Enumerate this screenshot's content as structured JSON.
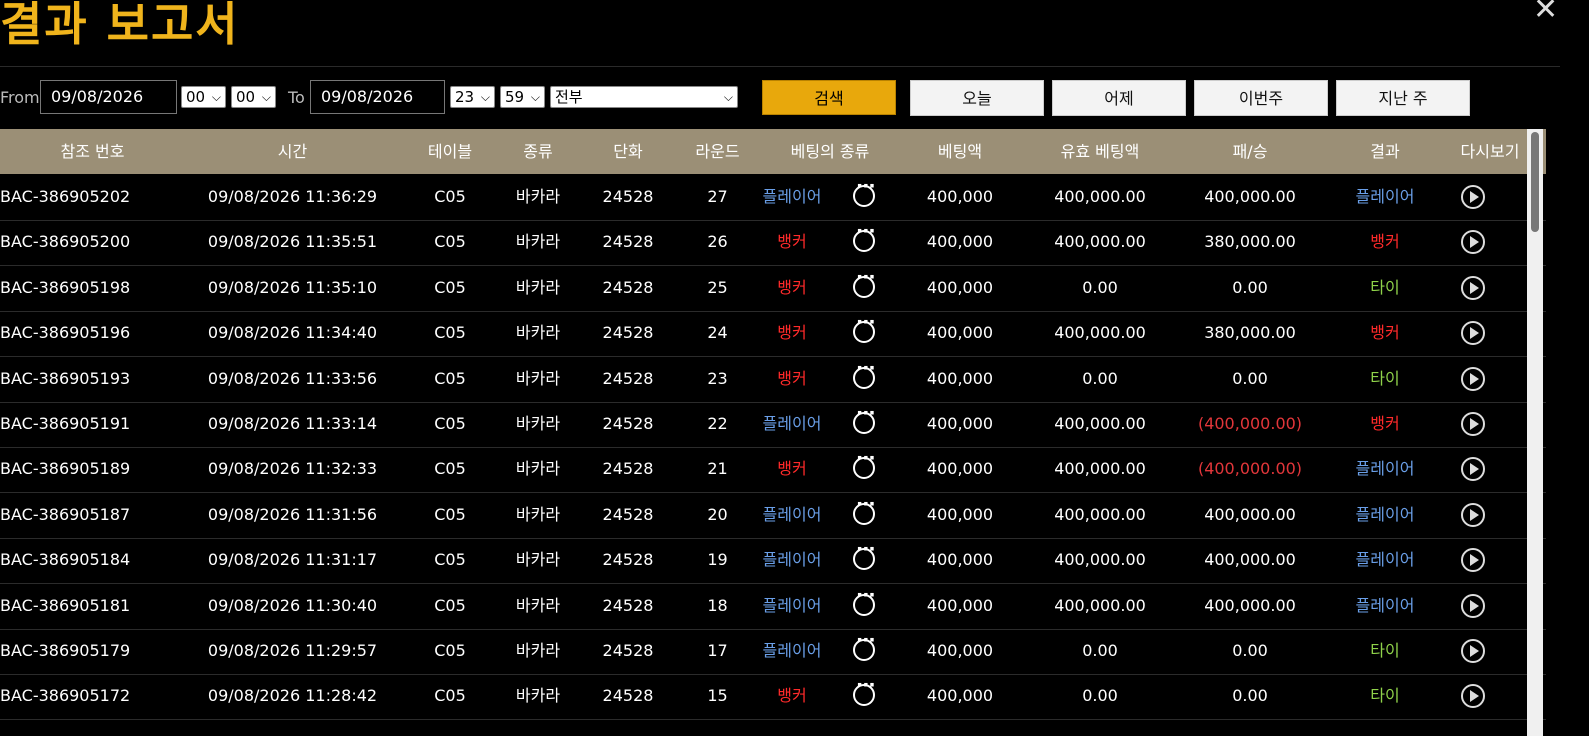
{
  "title": "결과 보고서",
  "close_icon": "close-icon",
  "filters": {
    "from_label": "From",
    "from_date": "09/08/2026",
    "from_hour": "00",
    "from_minute": "00",
    "to_label": "To",
    "to_date": "09/08/2026",
    "to_hour": "23",
    "to_minute": "59",
    "type_select": "전부",
    "search_button": "검색",
    "today_button": "오늘",
    "yesterday_button": "어제",
    "this_week_button": "이번주",
    "last_week_button": "지난 주"
  },
  "colors": {
    "accent": "#f0b41c",
    "header_bg": "#9b8f76",
    "player": "#6a9fe8",
    "banker": "#ff2a2a",
    "tie": "#8fd24a"
  },
  "table": {
    "headers": [
      "참조 번호",
      "시간",
      "테이블",
      "종류",
      "단화",
      "라운드",
      "베팅의 종류",
      "베팅액",
      "유효 베팅액",
      "패/승",
      "결과",
      "다시보기"
    ],
    "rows": [
      {
        "ref": "BAC-386905202",
        "time": "09/08/2026 11:36:29",
        "table": "C05",
        "type": "바카라",
        "shoe": "24528",
        "round": "27",
        "bet_type": "플레이어",
        "bet_amount": "400,000",
        "valid_bet": "400,000.00",
        "win_loss": "400,000.00",
        "result": "플레이어"
      },
      {
        "ref": "BAC-386905200",
        "time": "09/08/2026 11:35:51",
        "table": "C05",
        "type": "바카라",
        "shoe": "24528",
        "round": "26",
        "bet_type": "뱅커",
        "bet_amount": "400,000",
        "valid_bet": "400,000.00",
        "win_loss": "380,000.00",
        "result": "뱅커"
      },
      {
        "ref": "BAC-386905198",
        "time": "09/08/2026 11:35:10",
        "table": "C05",
        "type": "바카라",
        "shoe": "24528",
        "round": "25",
        "bet_type": "뱅커",
        "bet_amount": "400,000",
        "valid_bet": "0.00",
        "win_loss": "0.00",
        "result": "타이"
      },
      {
        "ref": "BAC-386905196",
        "time": "09/08/2026 11:34:40",
        "table": "C05",
        "type": "바카라",
        "shoe": "24528",
        "round": "24",
        "bet_type": "뱅커",
        "bet_amount": "400,000",
        "valid_bet": "400,000.00",
        "win_loss": "380,000.00",
        "result": "뱅커"
      },
      {
        "ref": "BAC-386905193",
        "time": "09/08/2026 11:33:56",
        "table": "C05",
        "type": "바카라",
        "shoe": "24528",
        "round": "23",
        "bet_type": "뱅커",
        "bet_amount": "400,000",
        "valid_bet": "0.00",
        "win_loss": "0.00",
        "result": "타이"
      },
      {
        "ref": "BAC-386905191",
        "time": "09/08/2026 11:33:14",
        "table": "C05",
        "type": "바카라",
        "shoe": "24528",
        "round": "22",
        "bet_type": "플레이어",
        "bet_amount": "400,000",
        "valid_bet": "400,000.00",
        "win_loss": "(400,000.00)",
        "result": "뱅커"
      },
      {
        "ref": "BAC-386905189",
        "time": "09/08/2026 11:32:33",
        "table": "C05",
        "type": "바카라",
        "shoe": "24528",
        "round": "21",
        "bet_type": "뱅커",
        "bet_amount": "400,000",
        "valid_bet": "400,000.00",
        "win_loss": "(400,000.00)",
        "result": "플레이어"
      },
      {
        "ref": "BAC-386905187",
        "time": "09/08/2026 11:31:56",
        "table": "C05",
        "type": "바카라",
        "shoe": "24528",
        "round": "20",
        "bet_type": "플레이어",
        "bet_amount": "400,000",
        "valid_bet": "400,000.00",
        "win_loss": "400,000.00",
        "result": "플레이어"
      },
      {
        "ref": "BAC-386905184",
        "time": "09/08/2026 11:31:17",
        "table": "C05",
        "type": "바카라",
        "shoe": "24528",
        "round": "19",
        "bet_type": "플레이어",
        "bet_amount": "400,000",
        "valid_bet": "400,000.00",
        "win_loss": "400,000.00",
        "result": "플레이어"
      },
      {
        "ref": "BAC-386905181",
        "time": "09/08/2026 11:30:40",
        "table": "C05",
        "type": "바카라",
        "shoe": "24528",
        "round": "18",
        "bet_type": "플레이어",
        "bet_amount": "400,000",
        "valid_bet": "400,000.00",
        "win_loss": "400,000.00",
        "result": "플레이어"
      },
      {
        "ref": "BAC-386905179",
        "time": "09/08/2026 11:29:57",
        "table": "C05",
        "type": "바카라",
        "shoe": "24528",
        "round": "17",
        "bet_type": "플레이어",
        "bet_amount": "400,000",
        "valid_bet": "0.00",
        "win_loss": "0.00",
        "result": "타이"
      },
      {
        "ref": "BAC-386905172",
        "time": "09/08/2026 11:28:42",
        "table": "C05",
        "type": "바카라",
        "shoe": "24528",
        "round": "15",
        "bet_type": "뱅커",
        "bet_amount": "400,000",
        "valid_bet": "0.00",
        "win_loss": "0.00",
        "result": "타이"
      }
    ]
  }
}
